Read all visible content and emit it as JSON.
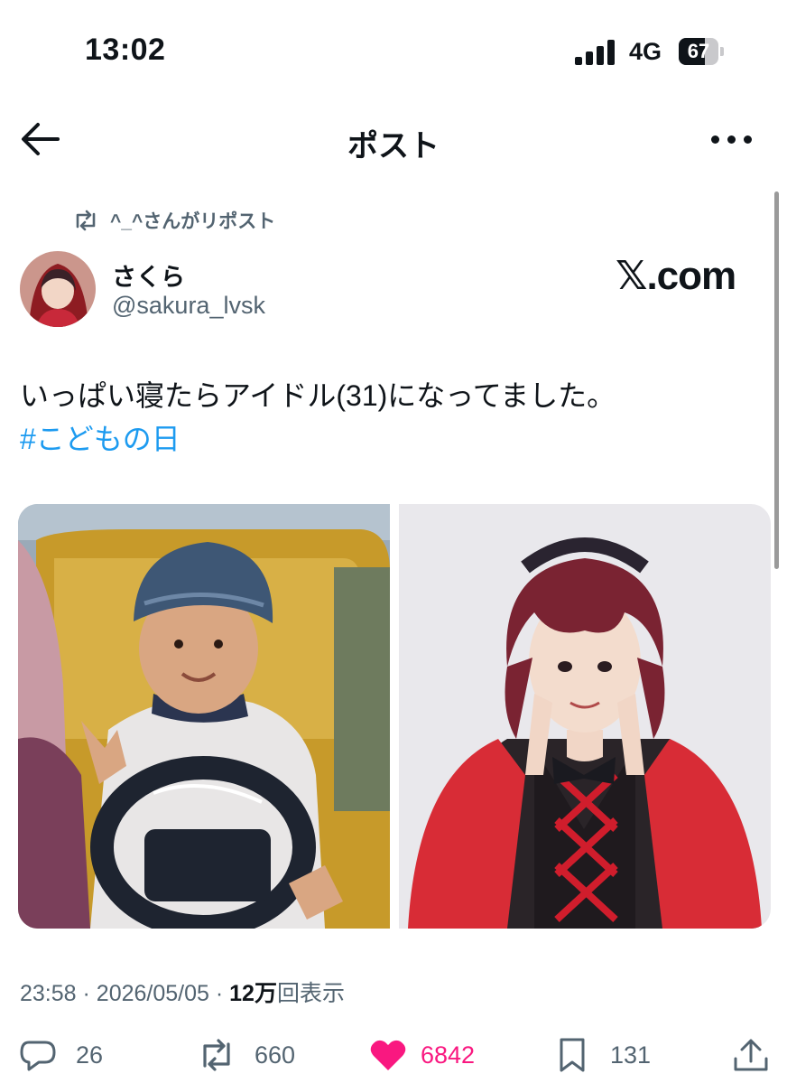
{
  "status_bar": {
    "time": "13:02",
    "network": "4G",
    "battery": "67",
    "battery_level": 0.67
  },
  "nav": {
    "title": "ポスト",
    "back_icon": "arrow-left-icon",
    "more_icon": "more-horizontal-icon"
  },
  "repost": {
    "text": "^_^さんがリポスト",
    "icon": "repost-icon"
  },
  "author": {
    "display_name": "さくら",
    "handle": "@sakura_lvsk"
  },
  "watermark": "𝕏.com",
  "post": {
    "text": "いっぱい寝たらアイドル(31)になってました。",
    "hashtag": "#こどもの日"
  },
  "media": [
    {
      "name": "childhood-photo",
      "alt": ""
    },
    {
      "name": "idol-photo",
      "alt": ""
    }
  ],
  "meta": {
    "time": "23:58",
    "date": "2026/05/05",
    "views_number": "12",
    "views_unit": "万",
    "views_label": "回表示",
    "separator": "·"
  },
  "actions": {
    "replies": "26",
    "reposts": "660",
    "likes": "6842",
    "bookmarks": "131",
    "like_color": "#f91880",
    "icons": [
      "reply-icon",
      "repost-icon",
      "heart-icon",
      "bookmark-icon",
      "share-icon"
    ]
  },
  "colors": {
    "text": "#0f1419",
    "secondary": "#536471",
    "link": "#1d9bf0",
    "like": "#f91880"
  }
}
